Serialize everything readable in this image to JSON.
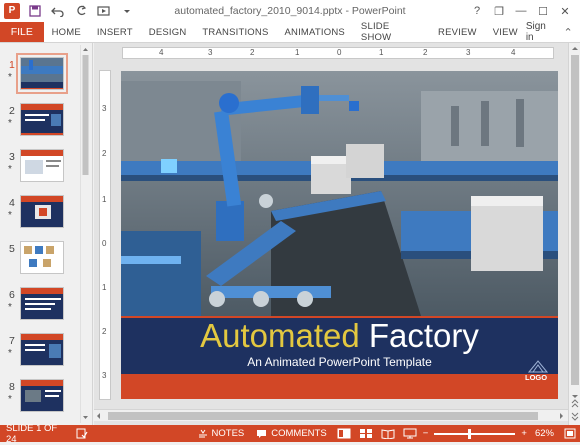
{
  "window": {
    "title": "automated_factory_2010_9014.pptx - PowerPoint",
    "app_logo": "P",
    "help": "?",
    "restore_down_glyph": "❐",
    "minimize_glyph": "—",
    "maximize_glyph": "☐",
    "close_glyph": "✕"
  },
  "ribbon": {
    "file": "FILE",
    "tabs": [
      "HOME",
      "INSERT",
      "DESIGN",
      "TRANSITIONS",
      "ANIMATIONS",
      "SLIDE SHOW",
      "REVIEW",
      "VIEW"
    ],
    "signin": "Sign in",
    "collapse_glyph": "⌃"
  },
  "thumbnails": [
    {
      "num": "1",
      "star": "*",
      "selected": true,
      "theme": "factory"
    },
    {
      "num": "2",
      "star": "*",
      "selected": false,
      "theme": "blue"
    },
    {
      "num": "3",
      "star": "*",
      "selected": false,
      "theme": "white"
    },
    {
      "num": "4",
      "star": "*",
      "selected": false,
      "theme": "blue"
    },
    {
      "num": "5",
      "star": "",
      "selected": false,
      "theme": "white"
    },
    {
      "num": "6",
      "star": "*",
      "selected": false,
      "theme": "blue"
    },
    {
      "num": "7",
      "star": "*",
      "selected": false,
      "theme": "blue"
    },
    {
      "num": "8",
      "star": "*",
      "selected": false,
      "theme": "blue"
    }
  ],
  "ruler": {
    "horizontal": [
      "4",
      "3",
      "2",
      "1",
      "0",
      "1",
      "2",
      "3",
      "4"
    ],
    "vertical": [
      "3",
      "2",
      "1",
      "0",
      "1",
      "2",
      "3"
    ]
  },
  "slide": {
    "title_word_1": "Automated",
    "title_word_2": "Factory",
    "subtitle": "An Animated PowerPoint Template",
    "logo": "LOGO",
    "accent_color": "#d24726",
    "band_color": "#1e3160",
    "title_color": "#e3c840"
  },
  "status": {
    "slide_indicator": "SLIDE 1 OF 24",
    "notes": "NOTES",
    "comments": "COMMENTS",
    "zoom_minus": "−",
    "zoom_plus": "+",
    "zoom": "62%"
  },
  "colors": {
    "brand": "#d24726",
    "chrome_bg": "#f0f0f0"
  }
}
